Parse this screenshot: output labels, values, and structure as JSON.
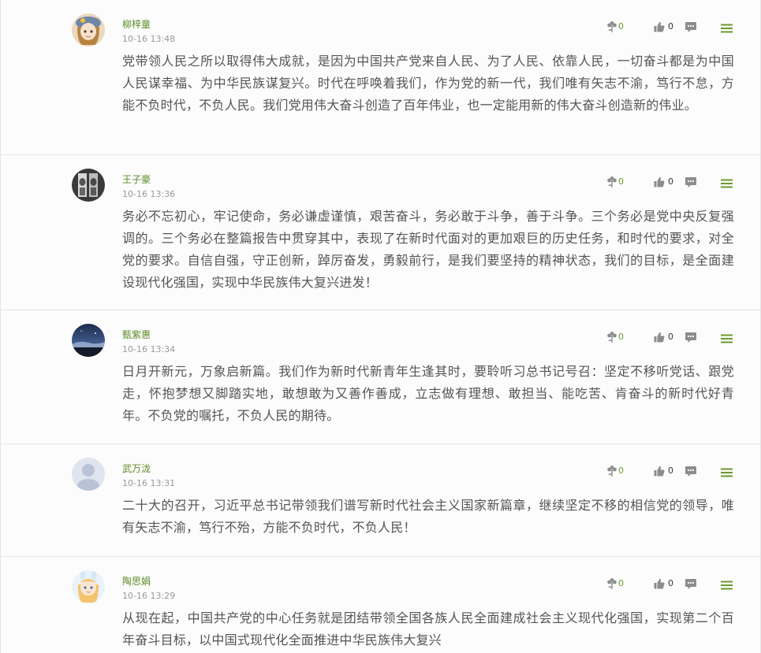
{
  "comments": [
    {
      "author": "柳梓童",
      "time": "10-16 13:48",
      "text": "党带领人民之所以取得伟大成就，是因为中国共产党来自人民、为了人民、依靠人民，一切奋斗都是为中国人民谋幸福、为中华民族谋复兴。时代在呼唤着我们，作为党的新一代，我们唯有矢志不渝，笃行不怠，方能不负时代，不负人民。我们党用伟大奋斗创造了百年伟业，也一定能用新的伟大奋斗创造新的伟业。",
      "flower_count": "0",
      "like_count": "0",
      "avatar": "cartoon-girl-hat"
    },
    {
      "author": "王子豪",
      "time": "10-16 13:36",
      "text": "务必不忘初心，牢记使命，务必谦虚谨慎，艰苦奋斗，务必敢于斗争，善于斗争。三个务必是党中央反复强调的。三个务必在整篇报告中贯穿其中，表现了在新时代面对的更加艰巨的历史任务，和时代的要求，对全党的要求。自信自强，守正创新，踔厉奋发，勇毅前行，是我们要坚持的精神状态，我们的目标，是全面建设现代化强国，实现中华民族伟大复兴进发！",
      "flower_count": "0",
      "like_count": "0",
      "avatar": "dark-photo"
    },
    {
      "author": "甄紫惠",
      "time": "10-16 13:34",
      "text": "日月开新元，万象启新篇。我们作为新时代新青年生逢其时，要聆听习总书记号召：坚定不移听党话、跟党走，怀抱梦想又脚踏实地，敢想敢为又善作善成，立志做有理想、敢担当、能吃苦、肯奋斗的新时代好青年。不负党的嘱托，不负人民的期待。",
      "flower_count": "0",
      "like_count": "0",
      "avatar": "night-sky"
    },
    {
      "author": "武万泷",
      "time": "10-16 13:31",
      "text": "二十大的召开，习近平总书记带领我们谱写新时代社会主义国家新篇章，继续坚定不移的相信党的领导，唯有矢志不渝，笃行不殆，方能不负时代，不负人民！",
      "flower_count": "0",
      "like_count": "0",
      "avatar": "default-user"
    },
    {
      "author": "陶思娟",
      "time": "10-16 13:29",
      "text": "从现在起，中国共产党的中心任务就是团结带领全国各族人民全面建成社会主义现代化强国，实现第二个百年奋斗目标，以中国式现代化全面推进中华民族伟大复兴",
      "flower_count": "0",
      "like_count": "0",
      "avatar": "cartoon-girl-bunny"
    }
  ],
  "colors": {
    "author": "#5b8a25",
    "count_green": "#6a9f2f",
    "icon_grey": "#8c8c8c",
    "menu_green": "#6c9a2e",
    "text": "#555555",
    "time": "#9a9a9a"
  },
  "icons": [
    "flower-icon",
    "thumbs-up-icon",
    "reply-icon",
    "menu-icon"
  ]
}
